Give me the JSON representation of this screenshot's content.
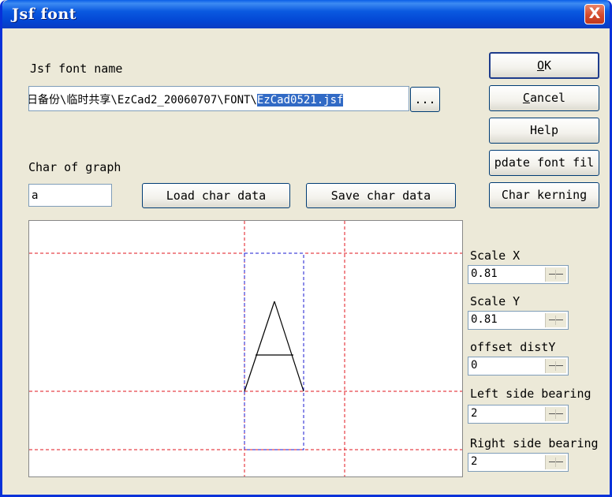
{
  "window": {
    "title": "Jsf font",
    "close": "X"
  },
  "font_name": {
    "label": "Jsf font name",
    "path_prefix": "日备份\\临时共享\\EzCad2_20060707\\FONT\\",
    "path_selected": "EzCad0521.jsf",
    "browse": "..."
  },
  "char": {
    "label": "Char of graph",
    "value": "a",
    "load": "Load char data",
    "save": "Save char data"
  },
  "buttons": {
    "ok_accel": "O",
    "ok_rest": "K",
    "cancel_accel": "C",
    "cancel_rest": "ancel",
    "help": "Help",
    "update": "pdate font fil",
    "kerning": "Char kerning"
  },
  "params": [
    {
      "label": "Scale X",
      "value": "0.81"
    },
    {
      "label": "Scale Y",
      "value": "0.81"
    },
    {
      "label": "offset distY",
      "value": "0"
    },
    {
      "label": "Left side bearing",
      "value": "2"
    },
    {
      "label": "Right side bearing",
      "value": "2"
    }
  ]
}
